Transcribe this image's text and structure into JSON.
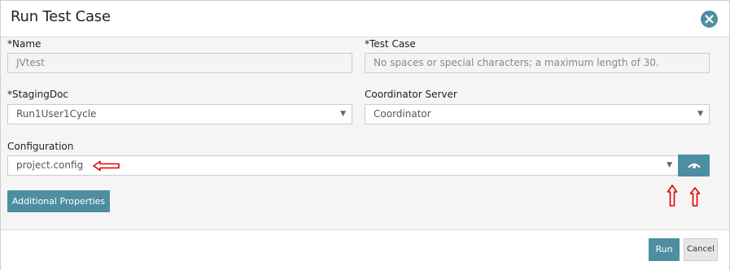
{
  "dialog": {
    "title": "Run Test Case",
    "close_icon": "close-icon"
  },
  "form": {
    "name": {
      "label": "*Name",
      "value": "JVtest"
    },
    "test_case": {
      "label": "*Test Case",
      "placeholder": "No spaces or special characters; a maximum length of 30."
    },
    "staging_doc": {
      "label": "*StagingDoc",
      "value": "Run1User1Cycle"
    },
    "coordinator_server": {
      "label": "Coordinator Server",
      "value": "Coordinator"
    },
    "configuration": {
      "label": "Configuration",
      "value": "project.config"
    },
    "caret": "▼",
    "view_icon": "eye-icon"
  },
  "buttons": {
    "additional_properties": "Additional Properties",
    "run": "Run",
    "cancel": "Cancel"
  },
  "colors": {
    "accent": "#4d8ea0",
    "annotation_arrow": "#e00000"
  }
}
